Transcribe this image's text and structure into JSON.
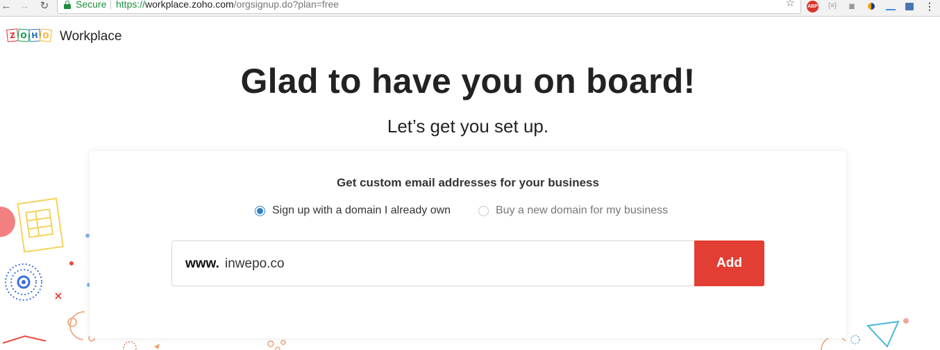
{
  "browser": {
    "secure_label": "Secure",
    "url_scheme": "https://",
    "url_host": "workplace.zoho.com",
    "url_path": "/orgsignup.do?plan=free",
    "extensions": {
      "abp": "ABP",
      "json": "{≡}"
    },
    "icons": [
      "back-arrow-icon",
      "forward-arrow-icon",
      "reload-icon",
      "lock-icon",
      "bookmark-star-icon",
      "adblock-plus-icon",
      "json-viewer-icon",
      "screenshot-camera-icon",
      "extension-dots-icon",
      "extension-line-icon",
      "extension-save-icon",
      "chrome-menu-icon"
    ]
  },
  "header": {
    "logo_letters": [
      "Z",
      "O",
      "H",
      "O"
    ],
    "logo_colors": [
      "#e42527",
      "#089949",
      "#226db4",
      "#f9b21d"
    ],
    "product": "Workplace"
  },
  "hero": {
    "title": "Glad to have you on board!",
    "subtitle": "Let’s get you set up."
  },
  "signup_card": {
    "title": "Get custom email addresses for your business",
    "options": [
      {
        "label": "Sign up with a domain I already own",
        "selected": true
      },
      {
        "label": "Buy a new domain for my business",
        "selected": false
      }
    ],
    "domain_prefix": "www.",
    "domain_value": "inwepo.co",
    "add_label": "Add"
  },
  "colors": {
    "accent_red": "#e33e33",
    "radio_blue": "#2f80c5",
    "secure_green": "#1e8e3e"
  }
}
